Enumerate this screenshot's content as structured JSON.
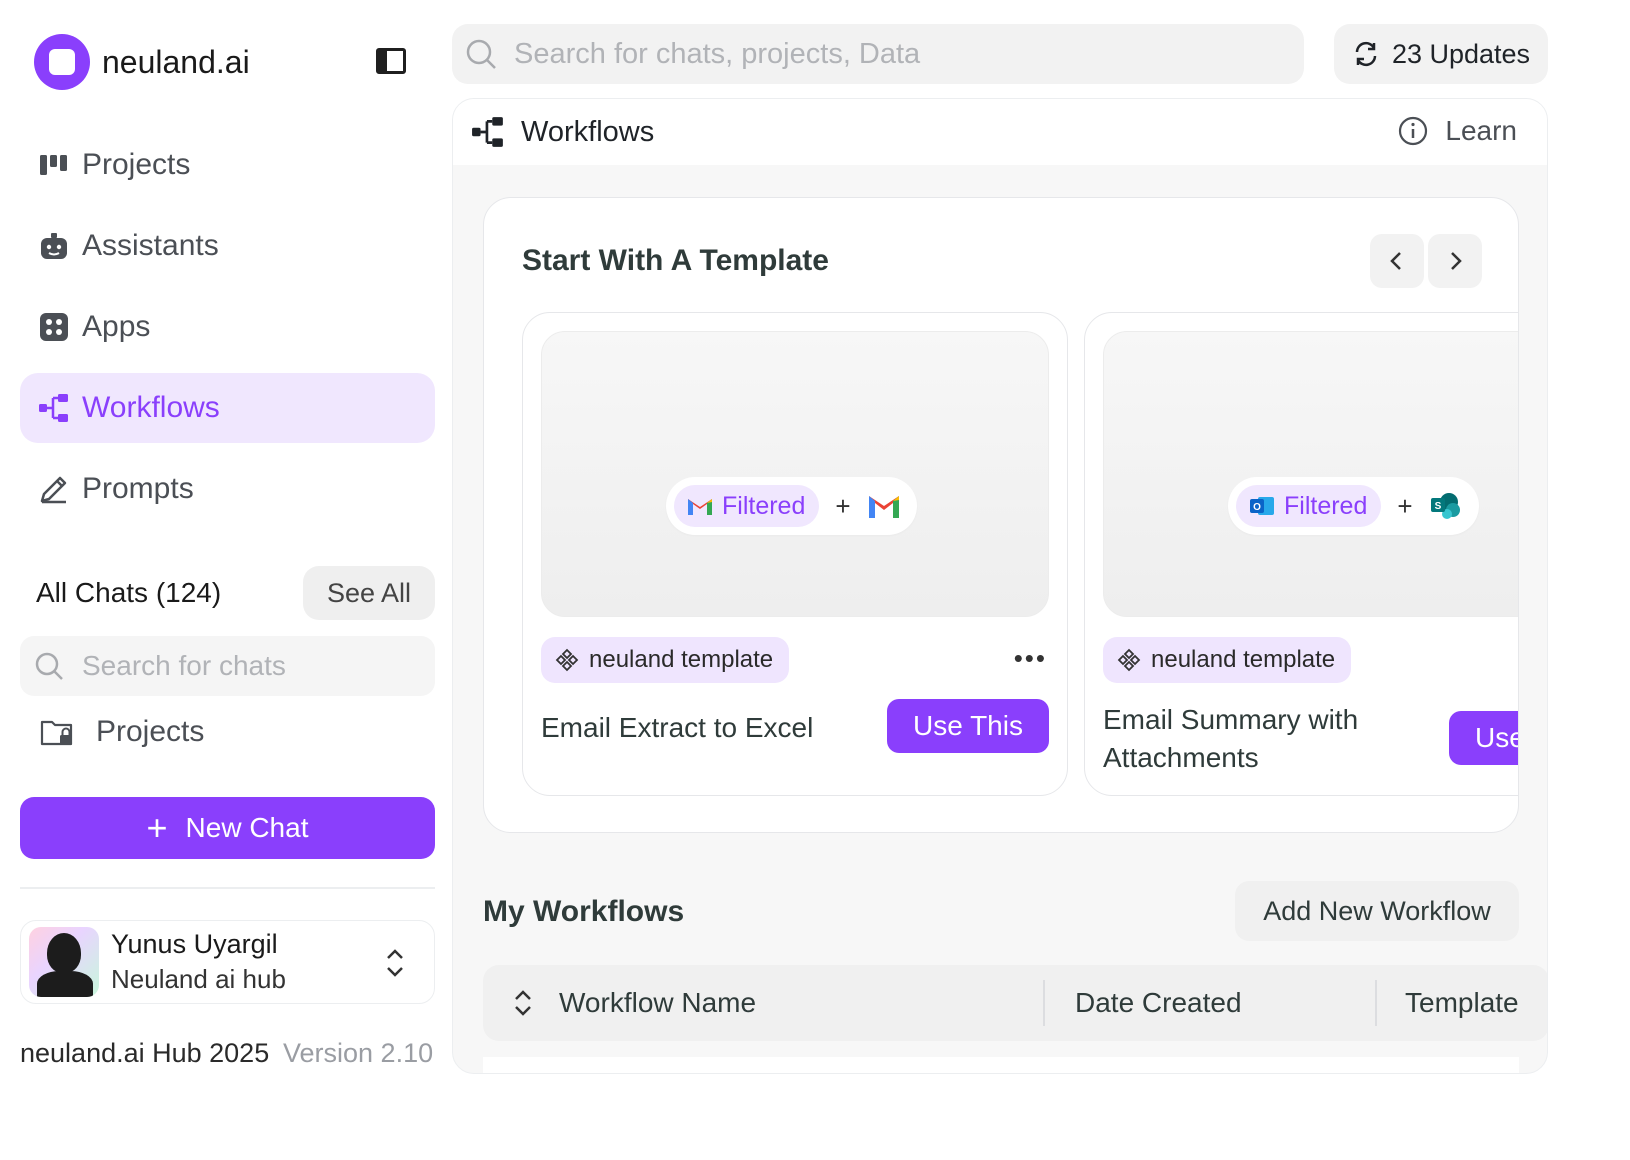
{
  "brand": {
    "name": "neuland.ai",
    "accent": "#8a3ffc"
  },
  "sidebar": {
    "nav": [
      {
        "label": "Projects",
        "icon": "projects-icon"
      },
      {
        "label": "Assistants",
        "icon": "assistant-icon"
      },
      {
        "label": "Apps",
        "icon": "apps-icon"
      },
      {
        "label": "Workflows",
        "icon": "workflow-icon",
        "active": true
      },
      {
        "label": "Prompts",
        "icon": "pencil-icon"
      }
    ],
    "chats_title": "All Chats (124)",
    "see_all": "See All",
    "chat_search_placeholder": "Search for chats",
    "projects_folder": "Projects",
    "new_chat": "New Chat",
    "user": {
      "name": "Yunus Uyargil",
      "org": "Neuland ai hub"
    },
    "footer": "neuland.ai Hub 2025",
    "version": "Version 2.10"
  },
  "topbar": {
    "search_placeholder": "Search for chats, projects, Data",
    "updates": "23 Updates"
  },
  "main": {
    "title": "Workflows",
    "learn": "Learn",
    "template_section": {
      "title": "Start With A Template",
      "cards": [
        {
          "filter_label": "Filtered",
          "source_app": "gmail-icon",
          "target_app": "gmail-icon",
          "tag": "neuland template",
          "name": "Email Extract to Excel",
          "action": "Use This"
        },
        {
          "filter_label": "Filtered",
          "source_app": "outlook-icon",
          "target_app": "sharepoint-icon",
          "tag": "neuland template",
          "name": "Email Summary with Attachments",
          "action": "Use This"
        }
      ]
    },
    "my_workflows": {
      "title": "My Workflows",
      "add_button": "Add New Workflow",
      "columns": [
        "Workflow Name",
        "Date Created",
        "Template"
      ]
    }
  }
}
